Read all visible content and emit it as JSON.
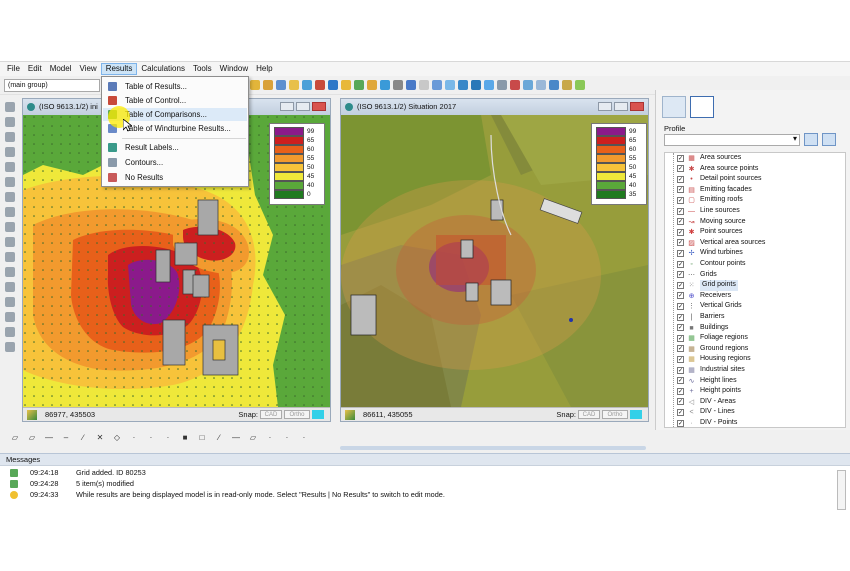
{
  "menu": [
    "File",
    "Edit",
    "Model",
    "View",
    "Results",
    "Calculations",
    "Tools",
    "Window",
    "Help"
  ],
  "active_menu": "Results",
  "group_combo": "(main group)",
  "results_menu": {
    "items": [
      {
        "label": "Table of Results...",
        "icon": "table-icon"
      },
      {
        "label": "Table of Control...",
        "icon": "control-table-icon"
      },
      {
        "label": "Table of Comparisons...",
        "icon": "comparison-table-icon"
      },
      {
        "label": "Table of Windturbine Results...",
        "icon": "windturbine-table-icon"
      },
      {
        "label": "Result Labels...",
        "icon": "result-labels-icon"
      },
      {
        "label": "Contours...",
        "icon": "contours-icon"
      },
      {
        "label": "No Results",
        "icon": "no-results-icon"
      }
    ]
  },
  "window_left": {
    "title": "(ISO 9613.1/2) ini",
    "coords": "86977, 435503",
    "snap_label": "Snap:",
    "snap_b1": "CAD",
    "snap_b2": "Ortho"
  },
  "window_right": {
    "title": "(ISO 9613.1/2) Situation 2017",
    "coords": "86611, 435055",
    "snap_label": "Snap:",
    "snap_b1": "CAD",
    "snap_b2": "Ortho"
  },
  "legend": {
    "levels": [
      "99",
      "65",
      "60",
      "55",
      "50",
      "45",
      "40",
      "0"
    ],
    "levels_right": [
      "99",
      "65",
      "60",
      "55",
      "50",
      "45",
      "40",
      "35"
    ],
    "colors": [
      "#8b1a8b",
      "#cc1f1f",
      "#e8601a",
      "#f29a2e",
      "#f7c33a",
      "#efe83a",
      "#5aa83a",
      "#1f7a1f"
    ]
  },
  "profile": {
    "label": "Profile",
    "layers": [
      {
        "label": "Area sources",
        "icon": "area-source-icon",
        "checked": true
      },
      {
        "label": "Area source points",
        "icon": "area-source-point-icon",
        "checked": true
      },
      {
        "label": "Detail point sources",
        "icon": "detail-point-icon",
        "checked": true
      },
      {
        "label": "Emitting facades",
        "icon": "facade-icon",
        "checked": true
      },
      {
        "label": "Emitting roofs",
        "icon": "roof-icon",
        "checked": true
      },
      {
        "label": "Line sources",
        "icon": "line-source-icon",
        "checked": true
      },
      {
        "label": "Moving source",
        "icon": "moving-source-icon",
        "checked": true
      },
      {
        "label": "Point sources",
        "icon": "point-source-icon",
        "checked": true
      },
      {
        "label": "Vertical area sources",
        "icon": "vertical-area-icon",
        "checked": true
      },
      {
        "label": "Wind turbines",
        "icon": "wind-turbine-icon",
        "checked": true
      },
      {
        "label": "Contour points",
        "icon": "contour-point-icon",
        "checked": true
      },
      {
        "label": "Grids",
        "icon": "grid-icon",
        "checked": true
      },
      {
        "label": "Grid points",
        "icon": "grid-point-icon",
        "checked": true,
        "selected": true
      },
      {
        "label": "Receivers",
        "icon": "receiver-icon",
        "checked": true
      },
      {
        "label": "Vertical Grids",
        "icon": "vertical-grid-icon",
        "checked": true
      },
      {
        "label": "Barriers",
        "icon": "barrier-icon",
        "checked": true
      },
      {
        "label": "Buildings",
        "icon": "building-icon",
        "checked": true
      },
      {
        "label": "Foliage regions",
        "icon": "foliage-icon",
        "checked": true
      },
      {
        "label": "Ground regions",
        "icon": "ground-icon",
        "checked": true
      },
      {
        "label": "Housing regions",
        "icon": "housing-icon",
        "checked": true
      },
      {
        "label": "Industrial sites",
        "icon": "industrial-icon",
        "checked": true
      },
      {
        "label": "Height lines",
        "icon": "height-line-icon",
        "checked": true
      },
      {
        "label": "Height points",
        "icon": "height-point-icon",
        "checked": true
      },
      {
        "label": "DIV - Areas",
        "icon": "div-area-icon",
        "checked": true
      },
      {
        "label": "DIV - Lines",
        "icon": "div-line-icon",
        "checked": true
      },
      {
        "label": "DIV - Points",
        "icon": "div-point-icon",
        "checked": true
      }
    ]
  },
  "messages": {
    "header": "Messages",
    "rows": [
      {
        "time": "09:24:18",
        "text": "Grid added. ID 80253",
        "icon": "info-icon"
      },
      {
        "time": "09:24:28",
        "text": "5 item(s) modified",
        "icon": "info-icon"
      },
      {
        "time": "09:24:33",
        "text": "While results are being displayed model is in read-only mode. Select \"Results | No Results\" to switch to edit mode.",
        "icon": "lightbulb-icon"
      }
    ]
  }
}
